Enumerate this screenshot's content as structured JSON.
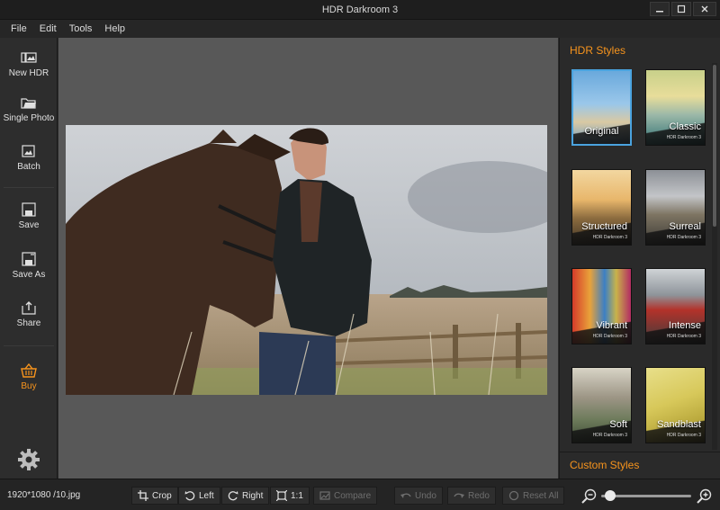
{
  "window": {
    "title": "HDR Darkroom 3"
  },
  "menu": [
    "File",
    "Edit",
    "Tools",
    "Help"
  ],
  "sidebar": {
    "new_hdr": "New HDR",
    "single_photo": "Single Photo",
    "batch": "Batch",
    "save": "Save",
    "save_as": "Save As",
    "share": "Share",
    "buy": "Buy"
  },
  "styles_panel": {
    "header": "HDR Styles",
    "custom_header": "Custom Styles",
    "watermark_text": "HDR Darkroom 3",
    "items": [
      {
        "name": "Original",
        "selected": true
      },
      {
        "name": "Classic",
        "selected": false
      },
      {
        "name": "Structured",
        "selected": false
      },
      {
        "name": "Surreal",
        "selected": false
      },
      {
        "name": "Vibrant",
        "selected": false
      },
      {
        "name": "Intense",
        "selected": false
      },
      {
        "name": "Soft",
        "selected": false
      },
      {
        "name": "Sandblast",
        "selected": false
      }
    ]
  },
  "status": {
    "info": "1920*1080 /10.jpg"
  },
  "toolbar": {
    "crop": "Crop",
    "left": "Left",
    "right": "Right",
    "one_to_one": "1:1",
    "compare": "Compare",
    "undo": "Undo",
    "redo": "Redo",
    "reset_all": "Reset All"
  },
  "zoom": {
    "level": 0.1
  },
  "colors": {
    "accent": "#f7941d",
    "selection": "#4aa3df"
  }
}
